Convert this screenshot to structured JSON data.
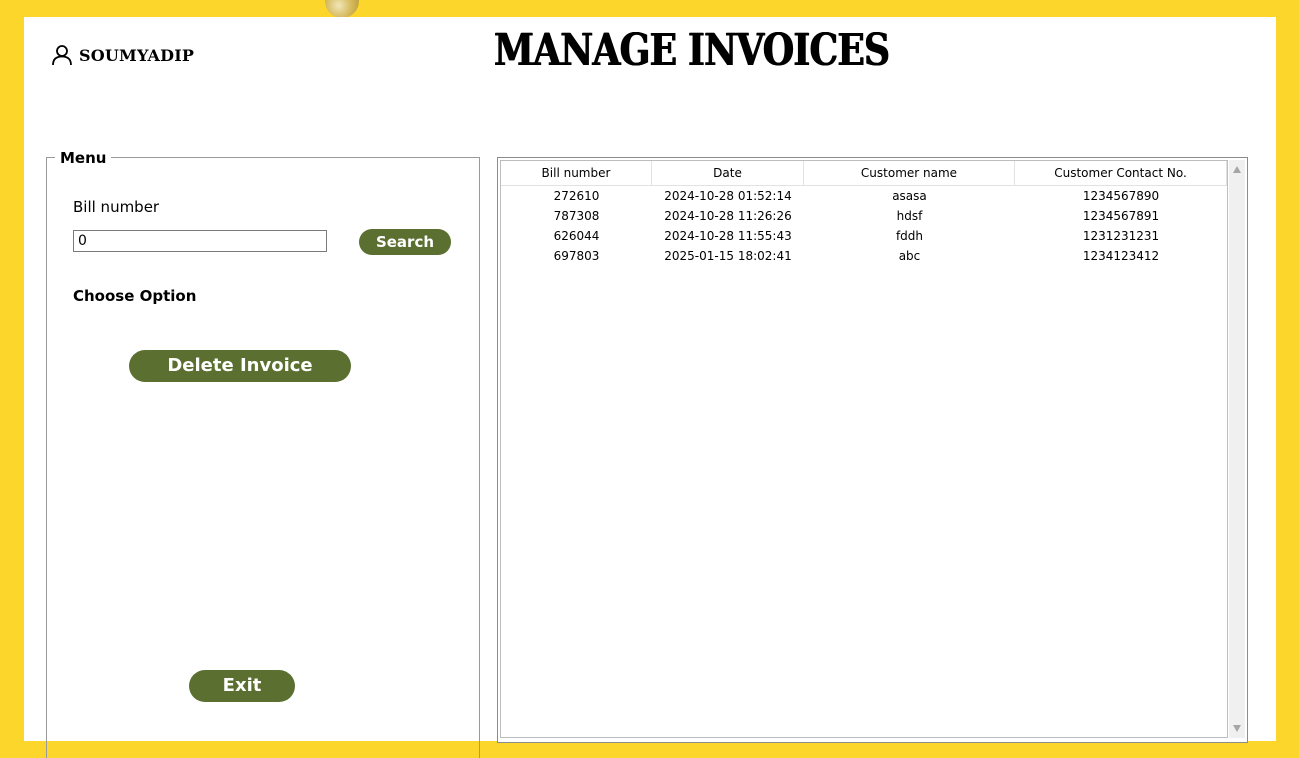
{
  "user": {
    "name": "SOUMYADIP",
    "icon": "user-icon"
  },
  "page": {
    "title": "MANAGE INVOICES"
  },
  "menu": {
    "legend": "Menu",
    "bill_label": "Bill number",
    "bill_value": "0",
    "search_label": "Search",
    "choose_label": "Choose Option",
    "delete_label": "Delete Invoice",
    "exit_label": "Exit"
  },
  "table": {
    "columns": [
      "Bill number",
      "Date",
      "Customer name",
      "Customer Contact No."
    ],
    "rows": [
      [
        "272610",
        "2024-10-28 01:52:14",
        "asasa",
        "1234567890"
      ],
      [
        "787308",
        "2024-10-28 11:26:26",
        "hdsf",
        "1234567891"
      ],
      [
        "626044",
        "2024-10-28 11:55:43",
        "fddh",
        "1231231231"
      ],
      [
        "697803",
        "2025-01-15 18:02:41",
        "abc",
        "1234123412"
      ]
    ]
  },
  "colors": {
    "background": "#fcd62a",
    "accent": "#5b7030",
    "panel": "#ffffff"
  }
}
